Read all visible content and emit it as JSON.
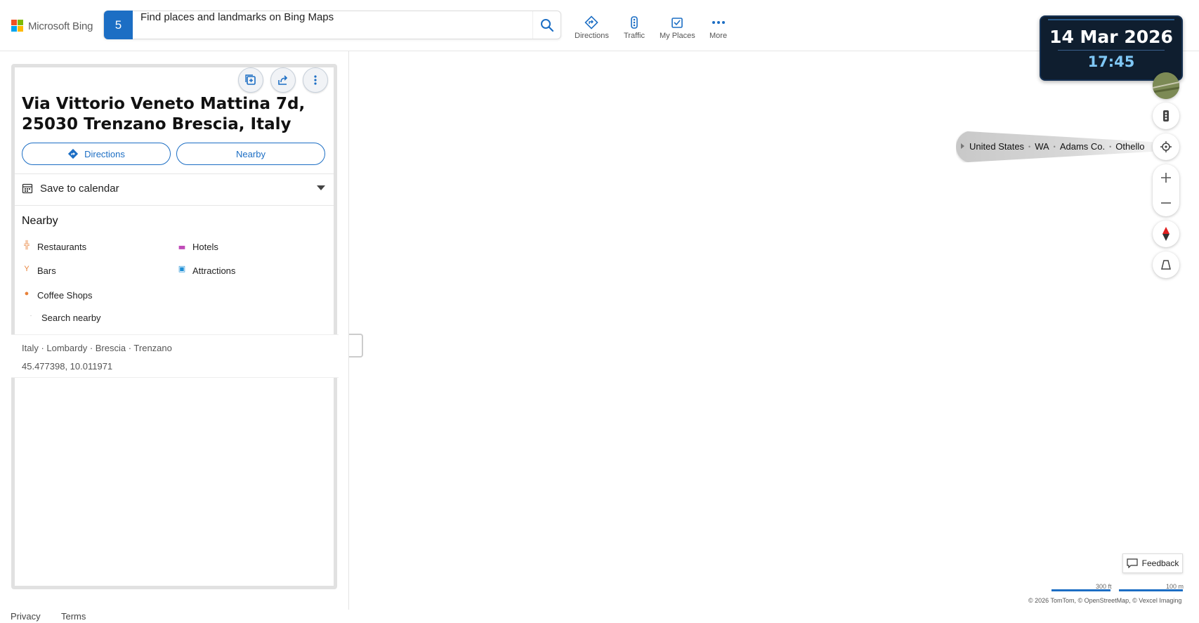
{
  "header": {
    "logo_text": "Microsoft Bing",
    "search_badge": "5",
    "search_value": "Find places and landmarks on Bing Maps",
    "nav": [
      {
        "label": "Directions",
        "icon": "directions-icon"
      },
      {
        "label": "Traffic",
        "icon": "traffic-icon"
      },
      {
        "label": "My Places",
        "icon": "my-places-icon"
      },
      {
        "label": "More",
        "icon": "more-icon"
      }
    ]
  },
  "datetime": {
    "date": "14 Mar 2026",
    "time": "17:45"
  },
  "panel": {
    "title": "Via Vittorio Veneto Mattina 7d, 25030 Trenzano Brescia, Italy",
    "directions_label": "Directions",
    "nearby_label": "Nearby",
    "calendar_label": "Save to calendar",
    "nearby_heading": "Nearby",
    "nearby_items": [
      {
        "label": "Restaurants",
        "icon": "restaurant-icon",
        "color": "#e8823a"
      },
      {
        "label": "Hotels",
        "icon": "hotel-icon",
        "color": "#c04bb8"
      },
      {
        "label": "Bars",
        "icon": "bar-icon",
        "color": "#e8823a"
      },
      {
        "label": "Attractions",
        "icon": "attraction-icon",
        "color": "#1e8fd6"
      },
      {
        "label": "Coffee Shops",
        "icon": "coffee-icon",
        "color": "#e8823a"
      }
    ],
    "search_nearby": "Search nearby",
    "hierarchy": "Italy · Lombardy · Brescia · Trenzano",
    "coordinates": "45.477398, 10.011971"
  },
  "map": {
    "breadcrumb": [
      "United States",
      "WA",
      "Adams Co.",
      "Othello"
    ],
    "feedback_label": "Feedback",
    "scale_ft": "300 ft",
    "scale_m": "100 m",
    "copyright": "© 2026 TomTom,  © OpenStreetMap, © Vexcel Imaging"
  },
  "footer": {
    "privacy": "Privacy",
    "terms": "Terms"
  },
  "colors": {
    "accent": "#1c6ec4",
    "widget_bg": "#0f1e2f",
    "time_color": "#7fc7f5"
  }
}
